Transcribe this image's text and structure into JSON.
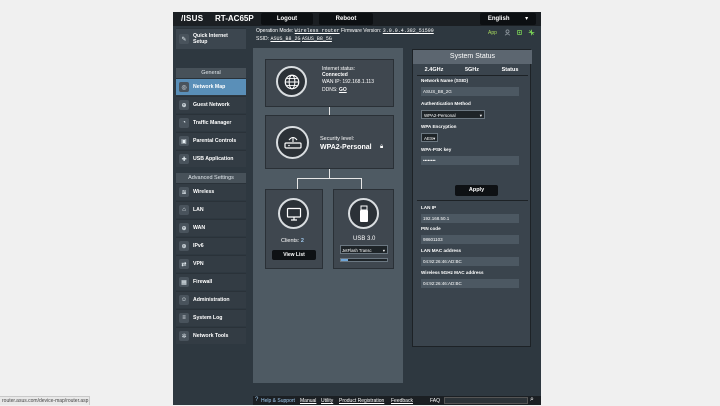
{
  "header": {
    "brand": "/ISUS",
    "model": "RT-AC65P",
    "logout_label": "Logout",
    "reboot_label": "Reboot",
    "language": "English"
  },
  "infobar": {
    "op_mode_label": "Operation Mode:",
    "op_mode_value": "Wireless router",
    "fw_label": "Firmware Version:",
    "fw_value": "3.0.0.4.382_51599",
    "ssid_label": "SSID:",
    "ssid_24": "ASUS_B8_2G",
    "ssid_5": "ASUS_B8_5G",
    "app_label": "App"
  },
  "sidebar": {
    "quick_setup": "Quick Internet Setup",
    "general_head": "General",
    "general_items": [
      "Network Map",
      "Guest Network",
      "Traffic Manager",
      "Parental Controls",
      "USB Application"
    ],
    "advanced_head": "Advanced Settings",
    "advanced_items": [
      "Wireless",
      "LAN",
      "WAN",
      "IPv6",
      "VPN",
      "Firewall",
      "Administration",
      "System Log",
      "Network Tools"
    ]
  },
  "map": {
    "internet_status_label": "Internet status:",
    "internet_status_value": "Connected",
    "wan_ip_label": "WAN IP:",
    "wan_ip_value": "192.168.1.113",
    "ddns_label": "DDNS:",
    "ddns_value": "GO",
    "security_label": "Security level:",
    "security_value": "WPA2-Personal",
    "clients_label": "Clients:",
    "clients_value": "2",
    "view_list_label": "View List",
    "usb_label": "USB 3.0",
    "usb_device": "JetFlash Transc",
    "usb_fill": 0.15
  },
  "status": {
    "title": "System Status",
    "tabs": [
      "2.4GHz",
      "5GHz",
      "Status"
    ],
    "ssid_label": "Network Name (SSID)",
    "ssid_value": "ASUS_B8_2G",
    "auth_label": "Authentication Method",
    "auth_value": "WPA2-Personal",
    "enc_label": "WPA Encryption",
    "enc_value": "AES",
    "psk_label": "WPA-PSK key",
    "psk_value": "••••••••",
    "apply_label": "Apply",
    "lan_ip_label": "LAN IP",
    "lan_ip_value": "192.168.50.1",
    "pin_label": "PIN code",
    "pin_value": "98601103",
    "lan_mac_label": "LAN MAC address",
    "lan_mac_value": "04:92:26:46:AD:BC",
    "wifi5_mac_label": "Wireless 5GHz MAC address",
    "wifi5_mac_value": "04:92:26:46:AD:BC"
  },
  "footer": {
    "help_label": "Help & Support",
    "manual": "Manual",
    "utility": "Utility",
    "product_reg": "Product Registration",
    "feedback": "Feedback",
    "faq": "FAQ"
  },
  "browser": {
    "status_url": "router.asus.com/device-map/router.asp"
  },
  "colors": {
    "frame_bg": "#2e3840",
    "header_bg": "#1b1f23",
    "active_item": "#5a8fb8",
    "app_green": "#a7d85c"
  }
}
